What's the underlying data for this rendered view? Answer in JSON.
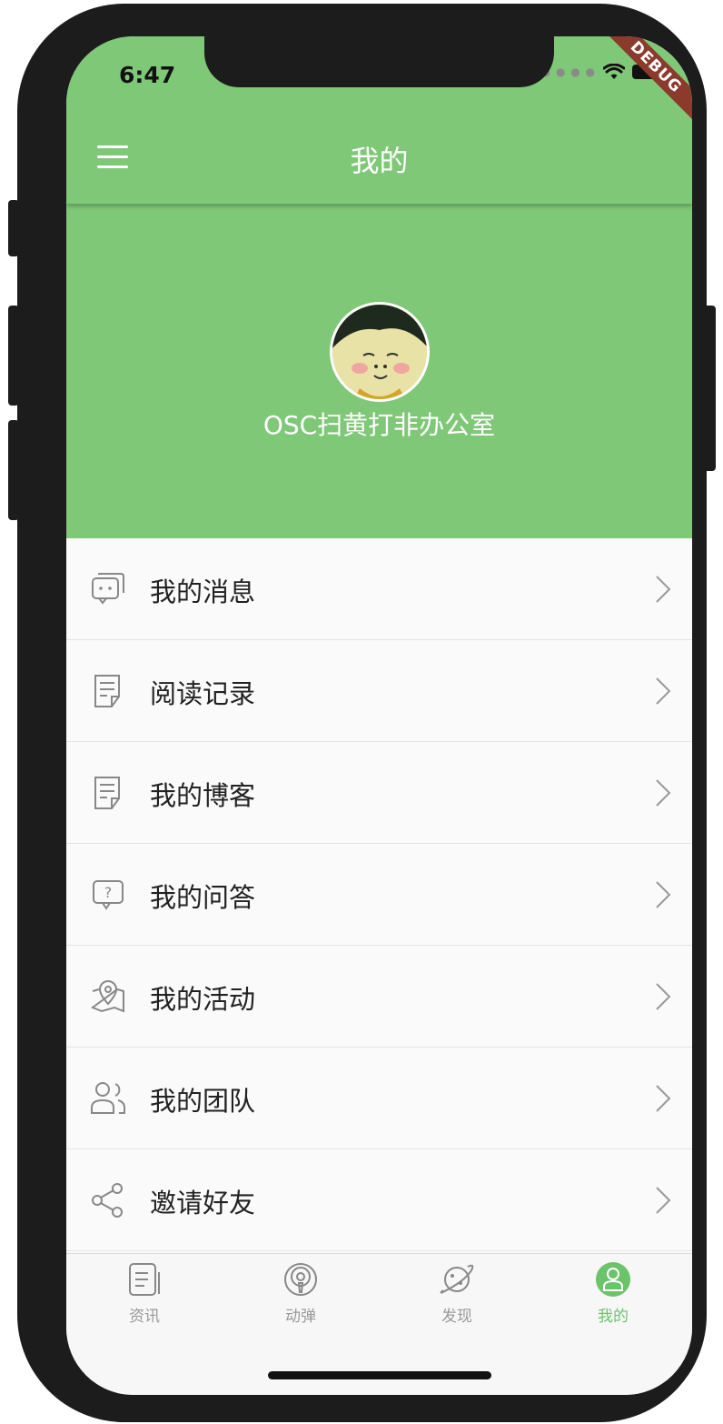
{
  "status_bar": {
    "time": "6:47"
  },
  "debug_banner": "DEBUG",
  "app_bar": {
    "title": "我的"
  },
  "profile": {
    "username": "OSC扫黄打非办公室"
  },
  "menu": [
    {
      "label": "我的消息",
      "icon": "message-icon"
    },
    {
      "label": "阅读记录",
      "icon": "document-icon"
    },
    {
      "label": "我的博客",
      "icon": "blog-icon"
    },
    {
      "label": "我的问答",
      "icon": "question-icon"
    },
    {
      "label": "我的活动",
      "icon": "map-location-icon"
    },
    {
      "label": "我的团队",
      "icon": "team-icon"
    },
    {
      "label": "邀请好友",
      "icon": "share-icon"
    }
  ],
  "tabs": [
    {
      "label": "资讯",
      "icon": "news-icon",
      "active": false
    },
    {
      "label": "动弹",
      "icon": "podcast-icon",
      "active": false
    },
    {
      "label": "发现",
      "icon": "planet-icon",
      "active": false
    },
    {
      "label": "我的",
      "icon": "user-icon",
      "active": true
    }
  ],
  "colors": {
    "primary": "#7fc877",
    "active_tab": "#6cc46a",
    "debug": "#8b3a2b"
  }
}
